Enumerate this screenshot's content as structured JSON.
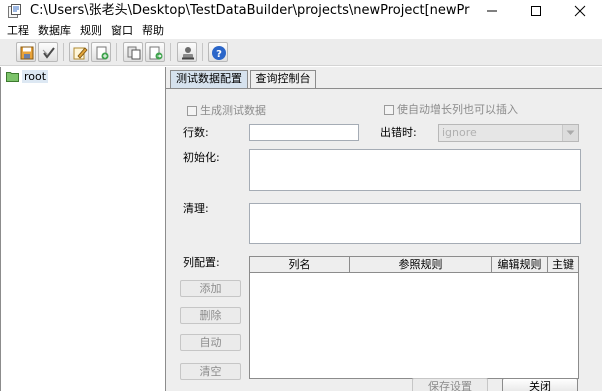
{
  "window": {
    "title": "C:\\Users\\张老头\\Desktop\\TestDataBuilder\\projects\\newProject[newProj...",
    "minimize_icon": "minimize-icon",
    "maximize_icon": "maximize-icon",
    "close_icon": "close-icon"
  },
  "menu": {
    "items": [
      "工程",
      "数据库",
      "规则",
      "窗口",
      "帮助"
    ]
  },
  "toolbar": {
    "buttons": [
      "save-icon",
      "checkmark-icon",
      "edit-icon",
      "new-icon",
      "copy-icon",
      "export-icon",
      "user-icon",
      "help-icon"
    ]
  },
  "tree": {
    "root_label": "root"
  },
  "tabs": {
    "active": "测试数据配置",
    "inactive": "查询控制台"
  },
  "form": {
    "generate_test_data_label": "生成测试数据",
    "allow_auto_increment_label": "使自动增长列也可以插入",
    "rows_label": "行数:",
    "rows_value": "",
    "on_error_label": "出错时:",
    "on_error_value": "ignore",
    "init_label": "初始化:",
    "cleanup_label": "清理:",
    "column_config_label": "列配置:"
  },
  "columns_table": {
    "headers": [
      "列名",
      "参照规则",
      "编辑规则",
      "主键"
    ]
  },
  "buttons": {
    "add": "添加",
    "delete": "删除",
    "auto": "自动",
    "clear": "清空",
    "save_settings": "保存设置",
    "close": "关闭"
  },
  "colors": {
    "active_tab": "#d6e2ee",
    "panel_bg": "#eeeeee",
    "disabled_text": "#8c8c8c"
  }
}
